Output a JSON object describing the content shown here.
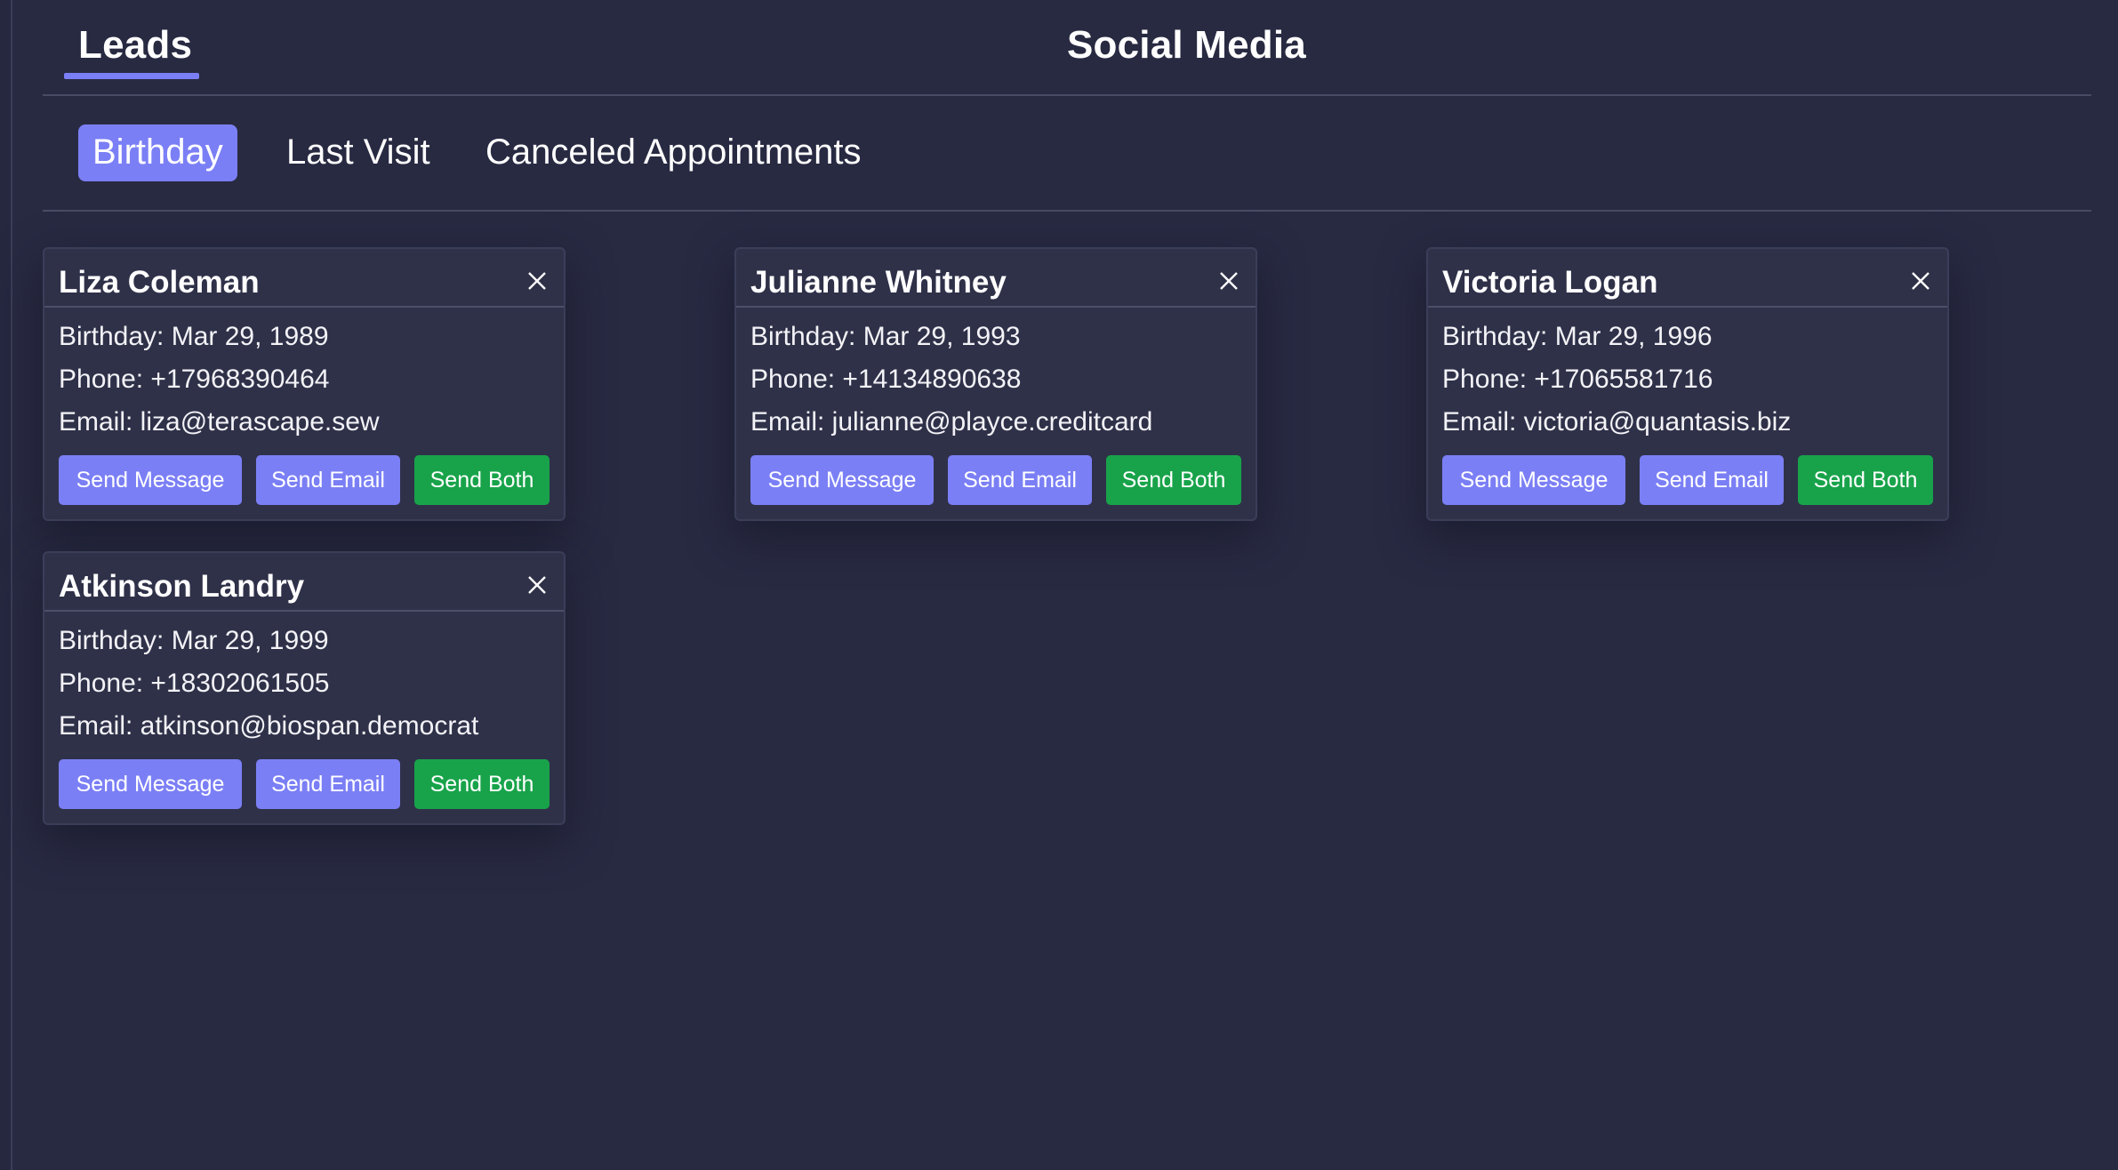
{
  "nav": {
    "tabs": [
      {
        "label": "Leads",
        "active": true
      },
      {
        "label": "Social Media",
        "active": false
      }
    ]
  },
  "filters": {
    "tabs": [
      {
        "label": "Birthday",
        "active": true
      },
      {
        "label": "Last Visit",
        "active": false
      },
      {
        "label": "Canceled Appointments",
        "active": false
      }
    ]
  },
  "leads": [
    {
      "name": "Liza Coleman",
      "birthday": "Birthday: Mar 29, 1989",
      "phone": "Phone: +17968390464",
      "email": "Email: liza@terascape.sew"
    },
    {
      "name": "Julianne Whitney",
      "birthday": "Birthday: Mar 29, 1993",
      "phone": "Phone: +14134890638",
      "email": "Email: julianne@playce.creditcard"
    },
    {
      "name": "Victoria Logan",
      "birthday": "Birthday: Mar 29, 1996",
      "phone": "Phone: +17065581716",
      "email": "Email: victoria@quantasis.biz"
    },
    {
      "name": "Atkinson Landry",
      "birthday": "Birthday: Mar 29, 1999",
      "phone": "Phone: +18302061505",
      "email": "Email: atkinson@biospan.democrat"
    }
  ],
  "actions": {
    "send_message": "Send Message",
    "send_email": "Send Email",
    "send_both": "Send Both"
  },
  "colors": {
    "background": "#282a42",
    "card": "#2f3149",
    "accent": "#7b7ff5",
    "success": "#18a34a"
  },
  "icons": {
    "close": "close-icon"
  }
}
